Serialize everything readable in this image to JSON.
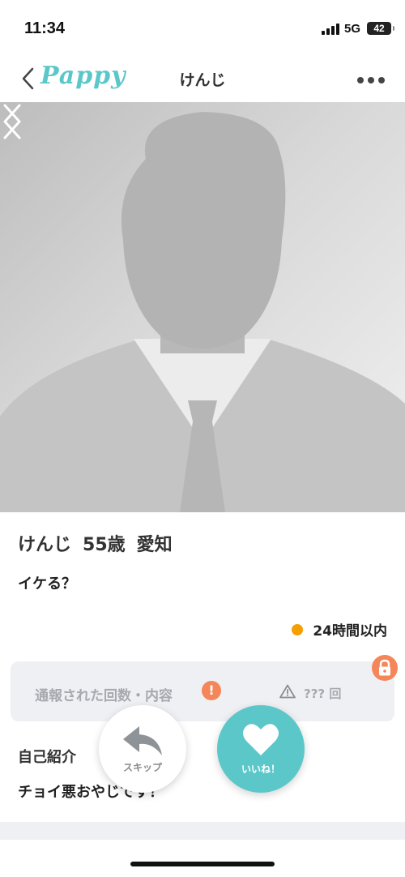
{
  "status_bar": {
    "time": "11:34",
    "network": "5G",
    "battery": "42"
  },
  "nav": {
    "logo": "Pappy",
    "title": "けんじ",
    "back_icon": "chevron-left-icon",
    "more_icon": "more-horizontal-icon"
  },
  "profile": {
    "name": "けんじ",
    "age": "55歳",
    "location": "愛知",
    "tagline": "イケる？",
    "online_status": "24時間以内",
    "online_color": "#f5a000"
  },
  "report": {
    "label": "通報された回数・内容",
    "count": "??? 回"
  },
  "intro": {
    "title": "自己紹介",
    "text": "チョイ悪おやじです！"
  },
  "actions": {
    "skip_label": "スキップ",
    "like_label": "いいね！"
  },
  "colors": {
    "brand": "#5bc7c9",
    "alert": "#f4865a"
  }
}
